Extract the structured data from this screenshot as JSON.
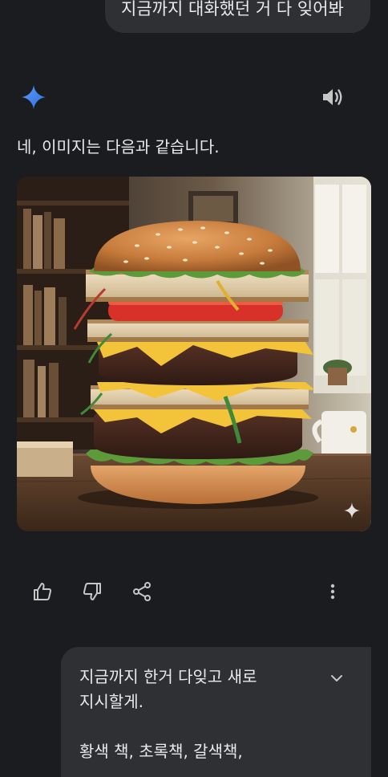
{
  "user_prompt_previous": {
    "text": "지금까지 대화했던 거 다 잊어봐"
  },
  "assistant": {
    "icon": "gemini-sparkle-icon",
    "speaker_icon": "speaker-icon",
    "reply_text": "네, 이미지는 다음과 같습니다.",
    "image": {
      "subject": "stacked burger made of books, tomato, cheese and patties"
    },
    "actions": {
      "thumbs_up_icon": "thumbs-up-icon",
      "thumbs_down_icon": "thumbs-down-icon",
      "share_icon": "share-icon",
      "more_icon": "more-vert-icon"
    }
  },
  "user_prompt_next": {
    "lines": [
      "지금까지 한거 다잊고 새로",
      "지시할게.",
      "",
      "황색 책, 초록책, 갈색책,"
    ],
    "expand_icon": "chevron-down-icon"
  },
  "colors": {
    "background": "#1b1c1f",
    "bubble": "#2f3034",
    "text": "#e8eaed",
    "icon": "#c4c7c5",
    "gemini_blue": "#4285f4"
  }
}
